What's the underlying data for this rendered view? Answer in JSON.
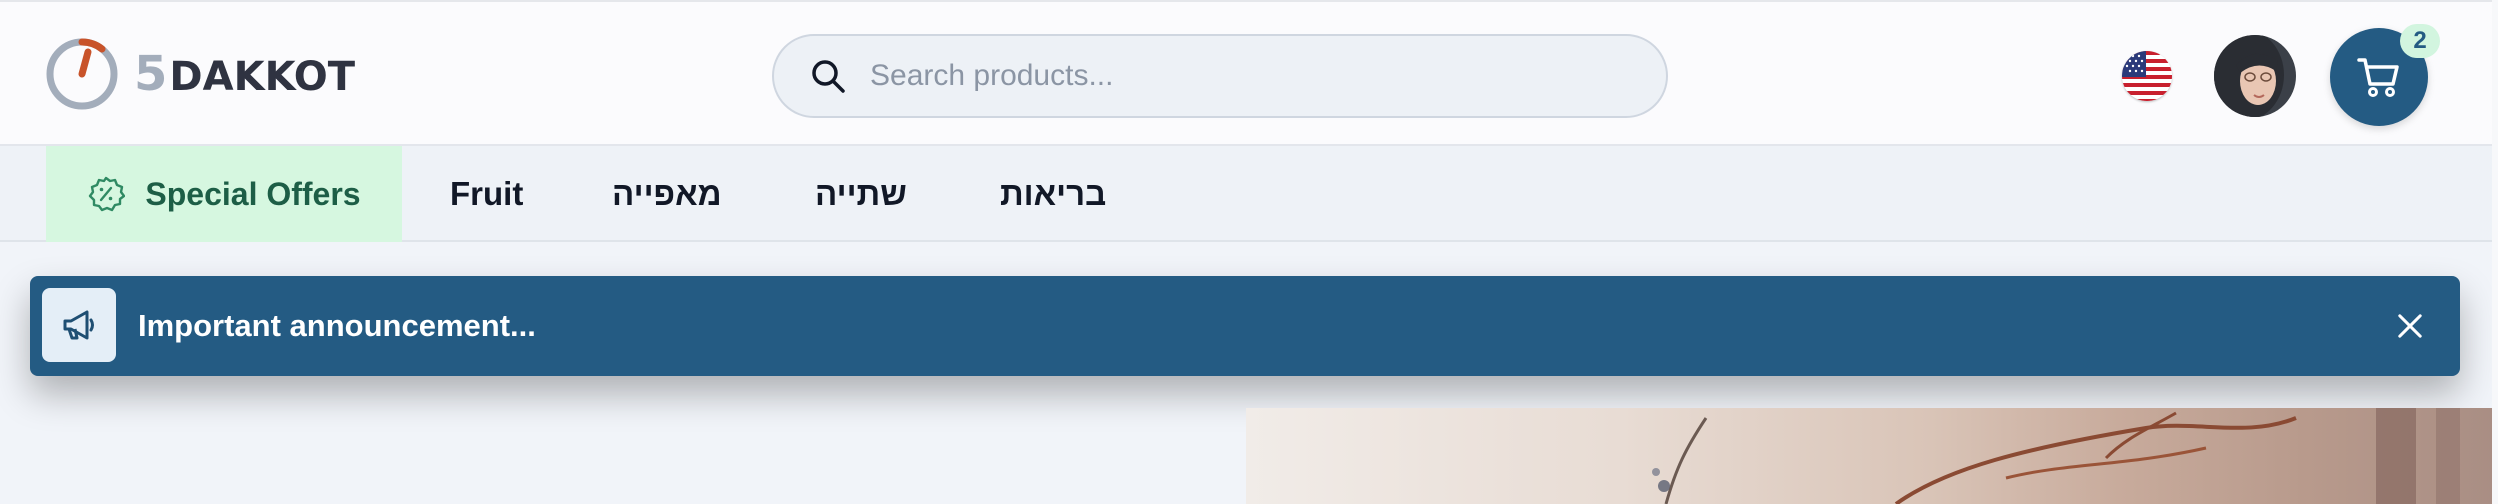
{
  "header": {
    "logo": {
      "digit": "5",
      "word": "DAKKOT",
      "accent_color": "#c8532a"
    },
    "search": {
      "placeholder": "Search products...",
      "value": ""
    },
    "language_flag": "us-flag-icon",
    "cart": {
      "count": "2"
    }
  },
  "nav": {
    "special": {
      "label": "Special Offers",
      "icon": "discount-badge-icon"
    },
    "items": [
      {
        "label": "Fruit"
      },
      {
        "label": "מאפייה"
      },
      {
        "label": "שתייה"
      },
      {
        "label": "בריאות"
      }
    ]
  },
  "announcement": {
    "text": "Important announcement...",
    "icon": "megaphone-icon",
    "close_icon": "close-icon"
  },
  "colors": {
    "brand_primary": "#245b83",
    "special_bg": "#d6f7e0",
    "special_text": "#1d5e46",
    "page_bg": "#f1f4f9"
  }
}
